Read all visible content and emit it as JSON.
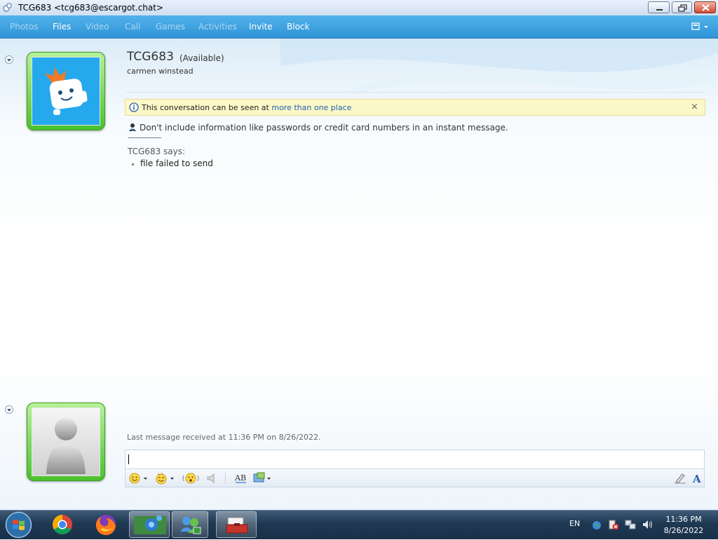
{
  "window": {
    "title": "TCG683 <tcg683@escargot.chat>"
  },
  "menu": {
    "items": [
      {
        "label": "Photos",
        "enabled": false
      },
      {
        "label": "Files",
        "enabled": true
      },
      {
        "label": "Video",
        "enabled": false
      },
      {
        "label": "Call",
        "enabled": false
      },
      {
        "label": "Games",
        "enabled": false
      },
      {
        "label": "Activities",
        "enabled": false
      },
      {
        "label": "Invite",
        "enabled": true
      },
      {
        "label": "Block",
        "enabled": true
      }
    ],
    "options_icon": "menu-options-icon"
  },
  "contact": {
    "name": "TCG683",
    "status": "(Available)",
    "personal_message": "carmen winstead"
  },
  "infobar": {
    "text": "This conversation can be seen at ",
    "link": "more than one place",
    "close": "×"
  },
  "warning": "Don't include information like passwords or credit card numbers in an instant message.",
  "conversation": {
    "sender_line": "TCG683 says:",
    "messages": [
      "file failed to send"
    ]
  },
  "status_line": "Last message received at 11:36 PM on 8/26/2022.",
  "input": {
    "value": ""
  },
  "toolbar": {
    "icons": [
      "emoticon-icon",
      "wink-icon",
      "nudge-icon",
      "voice-clip-icon",
      "spelling-icon",
      "background-icon",
      "handwriting-icon",
      "font-icon"
    ]
  },
  "taskbar": {
    "apps": [
      "chrome",
      "firefox",
      "control-panel",
      "messenger",
      "toolbox"
    ],
    "language": "EN",
    "time": "11:36 PM",
    "date": "8/26/2022"
  },
  "colors": {
    "menubar": "#3fa3e0",
    "avatar_frame": "#49c22d",
    "infobar": "#fcf8c7",
    "link": "#1f5fb5"
  }
}
